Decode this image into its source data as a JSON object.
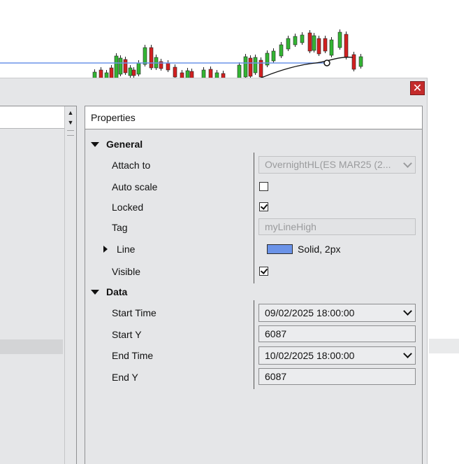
{
  "dialog": {
    "close_symbol": "✕",
    "panel_title": "Properties"
  },
  "categories": {
    "general": "General",
    "data": "Data"
  },
  "properties": {
    "attach_to": {
      "label": "Attach to",
      "value": "OvernightHL(ES MAR25 (2..."
    },
    "auto_scale": {
      "label": "Auto scale",
      "checked": false
    },
    "locked": {
      "label": "Locked",
      "checked": true
    },
    "tag": {
      "label": "Tag",
      "value": "myLineHigh"
    },
    "line": {
      "label": "Line",
      "value": "Solid, 2px",
      "color": "#6b93e8"
    },
    "visible": {
      "label": "Visible",
      "checked": true
    },
    "start_time": {
      "label": "Start Time",
      "value": "09/02/2025 18:00:00"
    },
    "start_y": {
      "label": "Start Y",
      "value": "6087"
    },
    "end_time": {
      "label": "End Time",
      "value": "10/02/2025 18:00:00"
    },
    "end_y": {
      "label": "End Y",
      "value": "6087"
    }
  },
  "colors": {
    "bull_candle": "#33b533",
    "bear_candle": "#d22020",
    "horizontal_line": "#6b93e8",
    "close_button": "#c42b2b"
  },
  "icons": {
    "close": "close-icon",
    "expand_down": "triangle-down-icon",
    "collapse_right": "triangle-right-icon",
    "scroll_up": "arrow-up-icon",
    "scroll_down": "arrow-down-icon",
    "dropdown": "chevron-down-icon"
  }
}
